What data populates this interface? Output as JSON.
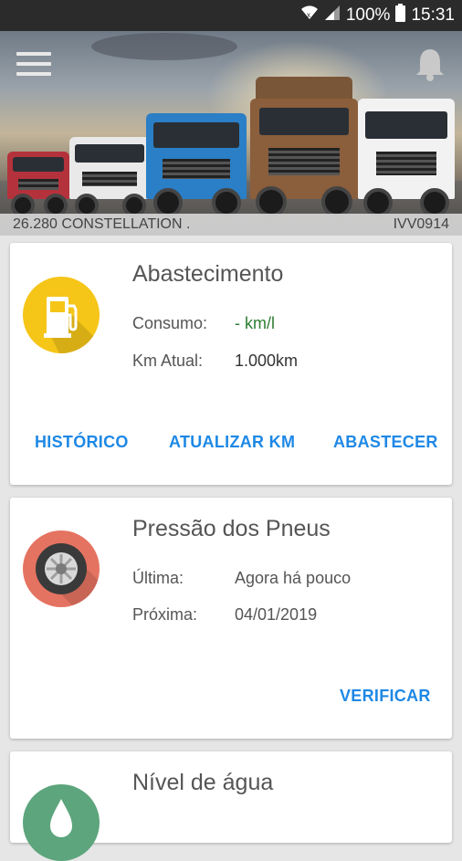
{
  "status_bar": {
    "battery": "100%",
    "time": "15:31"
  },
  "vehicle": {
    "model": "26.280 CONSTELLATION .",
    "plate": "IVV0914"
  },
  "cards": {
    "fuel": {
      "title": "Abastecimento",
      "consumption_label": "Consumo:",
      "consumption_value": "- km/l",
      "km_label": "Km Atual:",
      "km_value": "1.000km",
      "history_button": "HISTÓRICO",
      "update_km_button": "ATUALIZAR KM",
      "refuel_button": "ABASTECER",
      "icon_color": "#f5c518"
    },
    "tires": {
      "title": "Pressão dos Pneus",
      "last_label": "Última:",
      "last_value": "Agora há pouco",
      "next_label": "Próxima:",
      "next_value": "04/01/2019",
      "check_button": "VERIFICAR",
      "icon_color": "#e57361"
    },
    "water": {
      "title": "Nível de água",
      "icon_color": "#5da57c"
    }
  },
  "accent_color": "#1e88e5"
}
